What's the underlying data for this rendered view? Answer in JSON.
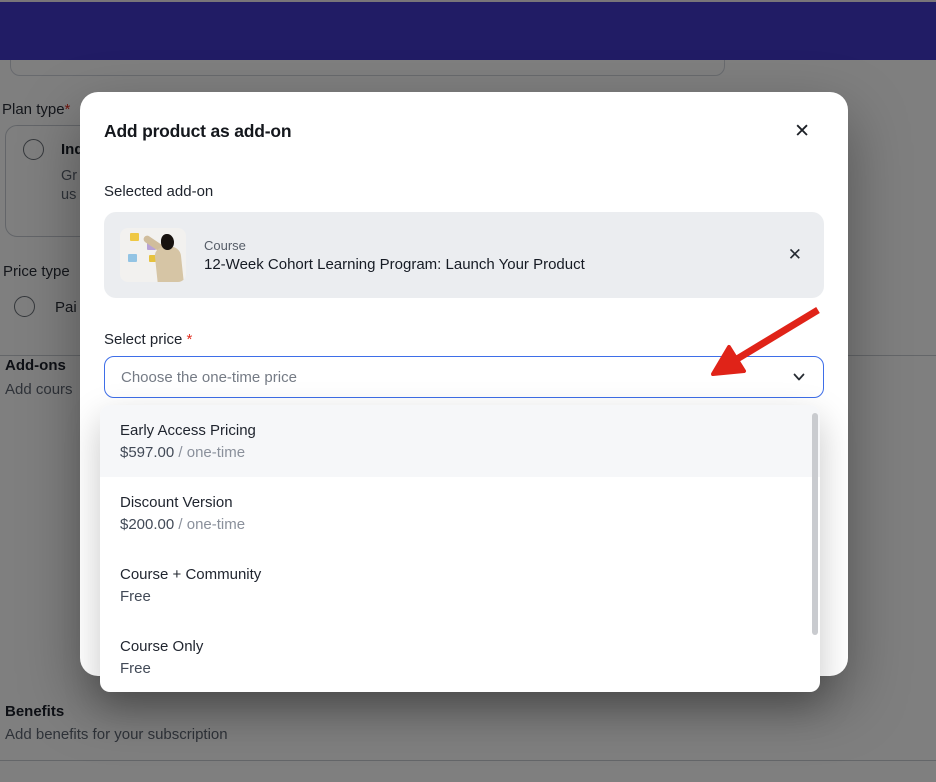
{
  "background": {
    "plan_type_label": "Plan type",
    "required_mark": "*",
    "plan_option_label": "Ind",
    "plan_option_desc_line1": "Gr",
    "plan_option_desc_line2": "us",
    "price_type_label": "Price type",
    "price_option_label": "Pai",
    "addons_title": "Add-ons",
    "addons_subtitle": "Add cours",
    "benefits_title": "Benefits",
    "benefits_subtitle": "Add benefits for your subscription",
    "header_color": "#4338ca"
  },
  "modal": {
    "title": "Add product as add-on",
    "close_icon": "✕",
    "selected_addon_label": "Selected add-on",
    "selected_card": {
      "type_label": "Course",
      "product_title": "12-Week Cohort Learning Program: Launch Your Product",
      "remove_icon": "✕"
    },
    "select_price_label": "Select price",
    "required_mark": "*",
    "select_placeholder": "Choose the one-time price"
  },
  "dropdown": {
    "options": [
      {
        "name": "Early Access Pricing",
        "amount": "$597.00",
        "suffix": " / one-time"
      },
      {
        "name": "Discount Version",
        "amount": "$200.00",
        "suffix": " / one-time"
      },
      {
        "name": "Course + Community",
        "amount": "Free",
        "suffix": ""
      },
      {
        "name": "Course Only",
        "amount": "Free",
        "suffix": ""
      }
    ]
  },
  "annotation": {
    "arrow_color": "#e02318"
  }
}
